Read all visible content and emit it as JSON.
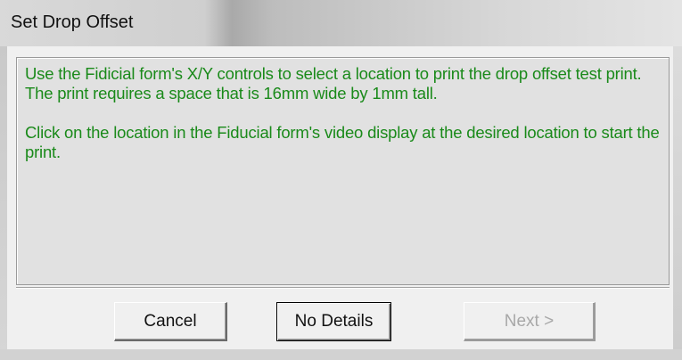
{
  "window": {
    "title": "Set Drop Offset"
  },
  "message": {
    "paragraph1": "Use the Fidicial form's X/Y controls to select a location to print the drop offset test print. The print requires a space that is 16mm wide by 1mm tall.",
    "paragraph2": "Click on the location in the Fiducial form's video display at the desired location to start the print.",
    "text_color": "#1a8a1a"
  },
  "buttons": {
    "cancel_label": "Cancel",
    "details_label": "No Details",
    "next_label": "Next >",
    "next_enabled": false
  }
}
